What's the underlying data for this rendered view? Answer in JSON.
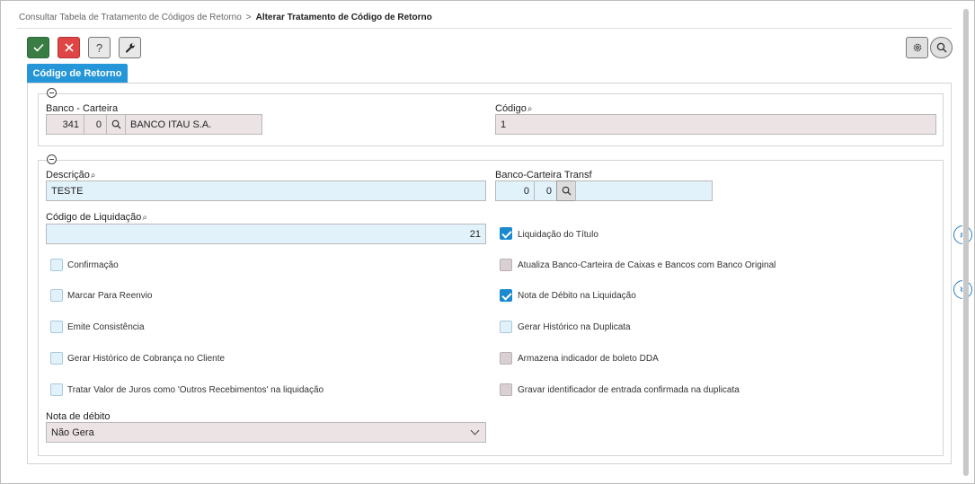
{
  "breadcrumb": {
    "parent": "Consultar Tabela de Tratamento de Códigos de Retorno",
    "separator": ">",
    "current": "Alterar Tratamento de Código de Retorno"
  },
  "toolbar": {
    "confirm_icon": "check-icon",
    "cancel_icon": "close-icon",
    "help_label": "?",
    "tools_icon": "wrench-icon",
    "settings_icon": "gear-icon",
    "search_icon": "search-icon"
  },
  "tab": {
    "label": "Código de Retorno"
  },
  "section1": {
    "banco_carteira": {
      "label": "Banco - Carteira",
      "banco": "341",
      "carteira": "0",
      "nome": "BANCO ITAU S.A."
    },
    "codigo": {
      "label": "Código",
      "value": "1"
    }
  },
  "section2": {
    "descricao": {
      "label": "Descrição",
      "value": "TESTE"
    },
    "banco_carteira_transf": {
      "label": "Banco-Carteira Transf",
      "banco": "0",
      "carteira": "0",
      "nome": ""
    },
    "codigo_liquidacao": {
      "label": "Código de Liquidação",
      "value": "21"
    },
    "checkboxes_left": [
      {
        "label": "Confirmação",
        "checked": false,
        "enabled": true
      },
      {
        "label": "Marcar Para Reenvio",
        "checked": false,
        "enabled": true
      },
      {
        "label": "Emite Consistência",
        "checked": false,
        "enabled": true
      },
      {
        "label": "Gerar Histórico de Cobrança no Cliente",
        "checked": false,
        "enabled": true
      },
      {
        "label": "Tratar Valor de Juros como 'Outros Recebimentos' na liquidação",
        "checked": false,
        "enabled": true
      }
    ],
    "checkboxes_right": [
      {
        "label": "Liquidação do Título",
        "checked": true,
        "enabled": true
      },
      {
        "label": "Atualiza Banco-Carteira de Caixas e Bancos com Banco Original",
        "checked": false,
        "enabled": false
      },
      {
        "label": "Nota de Débito na Liquidação",
        "checked": true,
        "enabled": true
      },
      {
        "label": "Gerar Histórico na Duplicata",
        "checked": false,
        "enabled": true
      },
      {
        "label": "Armazena indicador de boleto DDA",
        "checked": false,
        "enabled": false
      },
      {
        "label": "Gravar identificador de entrada confirmada na duplicata",
        "checked": false,
        "enabled": false
      }
    ],
    "nota_debito": {
      "label": "Nota de débito",
      "value": "Não Gera"
    }
  },
  "colors": {
    "accent": "#2596d8",
    "confirm": "#3a7d44",
    "cancel": "#e04545",
    "readonly_bg": "#ece3e5",
    "editable_bg": "#e2f2fb"
  }
}
